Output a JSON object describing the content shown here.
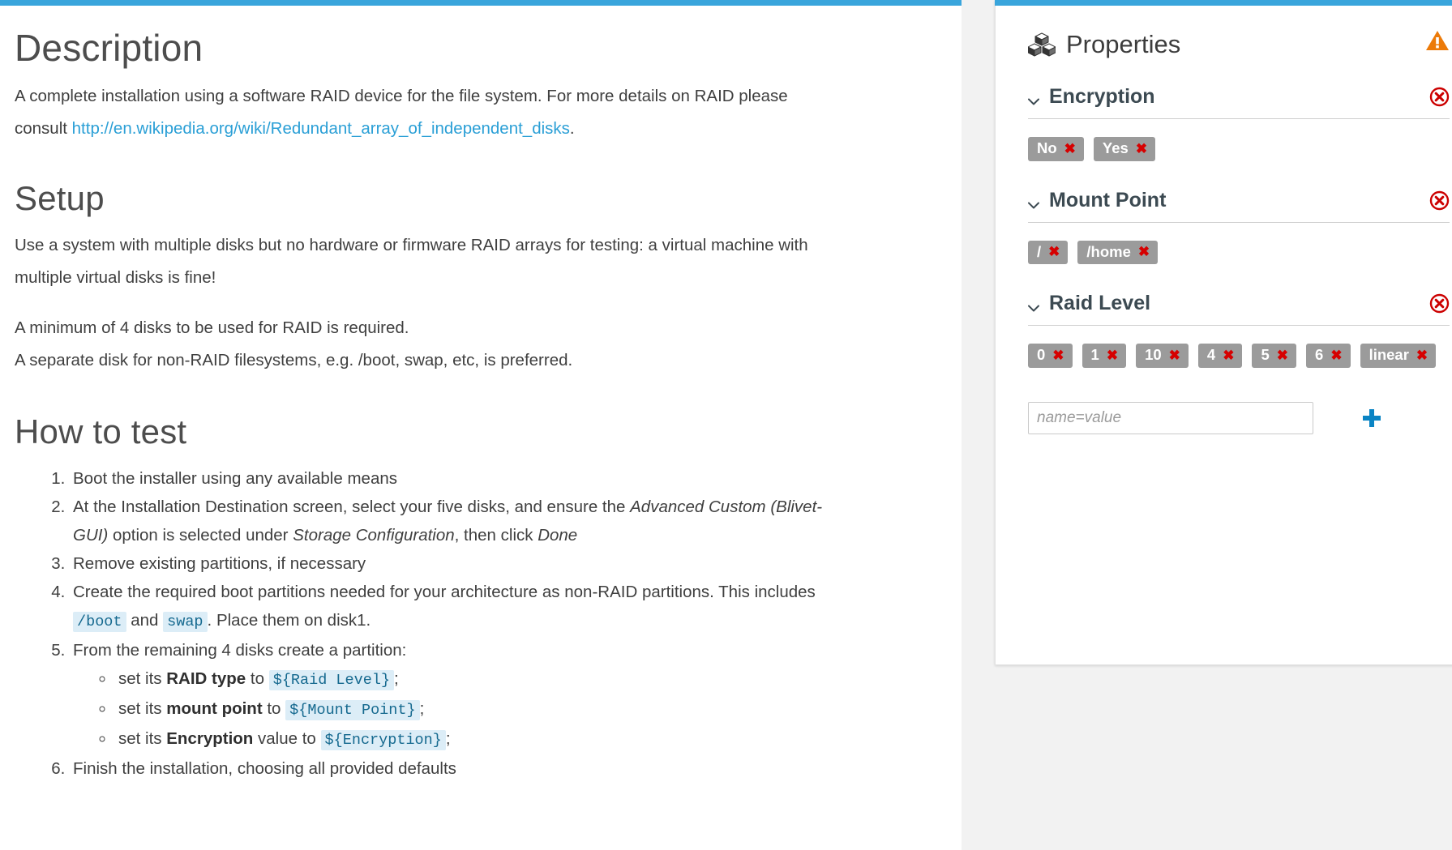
{
  "document": {
    "sections": [
      {
        "id": "description",
        "heading": "Description"
      },
      {
        "id": "setup",
        "heading": "Setup"
      },
      {
        "id": "howtotest",
        "heading": "How to test"
      }
    ],
    "description": {
      "text_before_link": "A complete installation using a software RAID device for the file system. For more details on RAID please consult ",
      "link_text": "http://en.wikipedia.org/wiki/Redundant_array_of_independent_disks",
      "text_after_link": "."
    },
    "setup": {
      "paragraph1": "Use a system with multiple disks but no hardware or firmware RAID arrays for testing: a virtual machine with multiple virtual disks is fine!",
      "paragraph2_line1": "A minimum of 4 disks to be used for RAID is required.",
      "paragraph2_line2": "A separate disk for non-RAID filesystems, e.g. /boot, swap, etc, is preferred."
    },
    "howtotest": {
      "step1": "Boot the installer using any available means",
      "step2": {
        "part1": "At the Installation Destination screen, select your five disks, and ensure the ",
        "em1": "Advanced Custom (Blivet-GUI)",
        "part2": " option is selected under ",
        "em2": "Storage Configuration",
        "part3": ", then click ",
        "em3": "Done"
      },
      "step3": "Remove existing partitions, if necessary",
      "step4": {
        "part1": "Create the required boot partitions needed for your architecture as non-RAID partitions. This includes ",
        "code1": "/boot",
        "part2": " and ",
        "code2": "swap",
        "part3": ". Place them on disk1."
      },
      "step5": {
        "lead": "From the remaining 4 disks create a partition:",
        "substeps": [
          {
            "pre": "set its ",
            "bold": "RAID type",
            "mid": " to ",
            "code": "${Raid Level}",
            "post": ";"
          },
          {
            "pre": "set its ",
            "bold": "mount point",
            "mid": " to ",
            "code": "${Mount Point}",
            "post": ";"
          },
          {
            "pre": "set its ",
            "bold": "Encryption",
            "mid": " value to ",
            "code": "${Encryption}",
            "post": ";"
          }
        ]
      },
      "step6": "Finish the installation, choosing all provided defaults"
    }
  },
  "properties_panel": {
    "title": "Properties",
    "icon": "cubes-icon",
    "warning_icon": "warning-triangle-icon",
    "add_input_placeholder": "name=value",
    "add_button_icon": "plus-icon",
    "sections": [
      {
        "name": "Encryption",
        "collapse_icon": "chevron-down-icon",
        "remove_icon": "remove-circle-icon",
        "tags": [
          "No",
          "Yes"
        ]
      },
      {
        "name": "Mount Point",
        "collapse_icon": "chevron-down-icon",
        "remove_icon": "remove-circle-icon",
        "tags": [
          "/",
          "/home"
        ]
      },
      {
        "name": "Raid Level",
        "collapse_icon": "chevron-down-icon",
        "remove_icon": "remove-circle-icon",
        "tags": [
          "0",
          "1",
          "10",
          "4",
          "5",
          "6",
          "linear"
        ]
      }
    ]
  },
  "colors": {
    "accent_blue": "#39a5dc",
    "link_blue": "#2a9fd6",
    "tag_gray": "#9b9b9b",
    "tag_x_red": "#d60000",
    "remove_red": "#cc0000",
    "warning_orange": "#ec7a08",
    "code_bg": "#dcedf7",
    "code_fg": "#15698f",
    "page_bg": "#f2f2f2"
  }
}
